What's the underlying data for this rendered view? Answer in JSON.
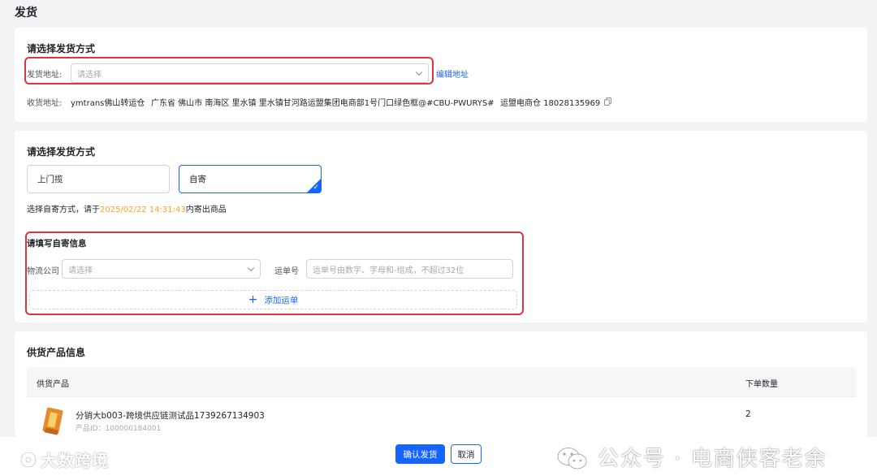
{
  "page": {
    "title": "发货"
  },
  "address_section": {
    "title": "请选择发货方式",
    "ship_address_label": "发货地址:",
    "ship_address_placeholder": "请选择",
    "edit_address_link": "编辑地址",
    "receive_label": "收货地址:",
    "receiver_name": "ymtrans佛山转运仓",
    "receiver_address": "广东省 佛山市 南海区 里水镇 里水镇甘河路运盟集团电商部1号门口绿色框@#CBU-PWURYS#",
    "receiver_contact": "运盟电商仓 18028135969"
  },
  "method_section": {
    "title": "请选择发货方式",
    "options": [
      {
        "label": "上门揽",
        "selected": false
      },
      {
        "label": "自寄",
        "selected": true
      }
    ],
    "notice_prefix": "选择自寄方式，请于",
    "notice_deadline": "2025/02/22 14:31:43",
    "notice_suffix": "内寄出商品",
    "self_ship_title": "请填写自寄信息",
    "logistics_label": "物流公司",
    "logistics_placeholder": "请选择",
    "tracking_label": "运单号",
    "tracking_placeholder": "运单号由数字、字母和-组成，不超过32位",
    "add_tracking": "添加运单",
    "add_icon": "+"
  },
  "product_section": {
    "title": "供货产品信息",
    "columns": [
      "供货产品",
      "下单数量"
    ],
    "rows": [
      {
        "name": "分销大b003-跨境供应链测试品1739267134903",
        "id": "产品ID：100000184001",
        "quantity": "2"
      }
    ]
  },
  "footer": {
    "confirm_label": "确认发货",
    "cancel_label": "取消"
  },
  "watermarks": {
    "left": "大数跨境",
    "right": "公众号 · 电商侠客老余"
  },
  "colors": {
    "primary": "#1664ff",
    "highlight": "#d9363e",
    "deadline": "#f5a623"
  }
}
